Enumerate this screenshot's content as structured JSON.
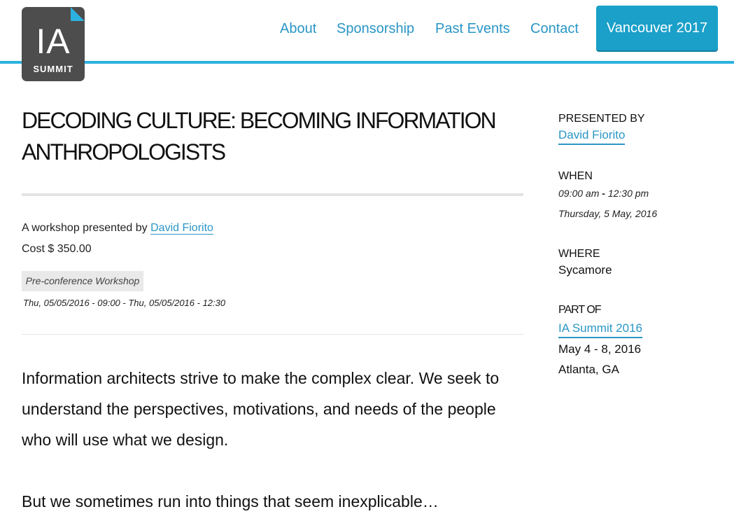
{
  "header": {
    "logo": {
      "line1": "IA",
      "line2": "SUMMIT"
    },
    "nav": [
      {
        "label": "About"
      },
      {
        "label": "Sponsorship"
      },
      {
        "label": "Past Events"
      },
      {
        "label": "Contact"
      }
    ],
    "cta_label": "Vancouver 2017",
    "accent_color": "#2cb2e0"
  },
  "main": {
    "title_line1": "DECODING CULTURE: BECOMING INFORMATION",
    "title_line2": "ANTHROPOLOGISTS",
    "presented_prefix": "A workshop presented by",
    "presenter_name": "David Fiorito",
    "cost": "Cost $ 350.00",
    "tag": "Pre-conference Workshop",
    "datetime": "Thu, 05/05/2016 - 09:00 - Thu, 05/05/2016 - 12:30",
    "body": [
      "Information architects strive to make the complex clear. We seek to understand the perspectives, motivations, and needs of the people who will use what we design.",
      "But we sometimes run into things that seem inexplicable…"
    ]
  },
  "sidebar": {
    "presented_by_label": "PRESENTED BY",
    "presented_by_name": "David Fiorito",
    "when_label": "WHEN",
    "when_time_start": "09:00 am",
    "when_time_sep": "-",
    "when_time_end": "12:30 pm",
    "when_date": "Thursday, 5 May, 2016",
    "where_label": "WHERE",
    "where_value": "Sycamore",
    "part_of_label": "PART OF",
    "part_of_link": "IA Summit 2016",
    "part_of_dates": "May 4 - 8, 2016",
    "part_of_location": "Atlanta, GA"
  }
}
